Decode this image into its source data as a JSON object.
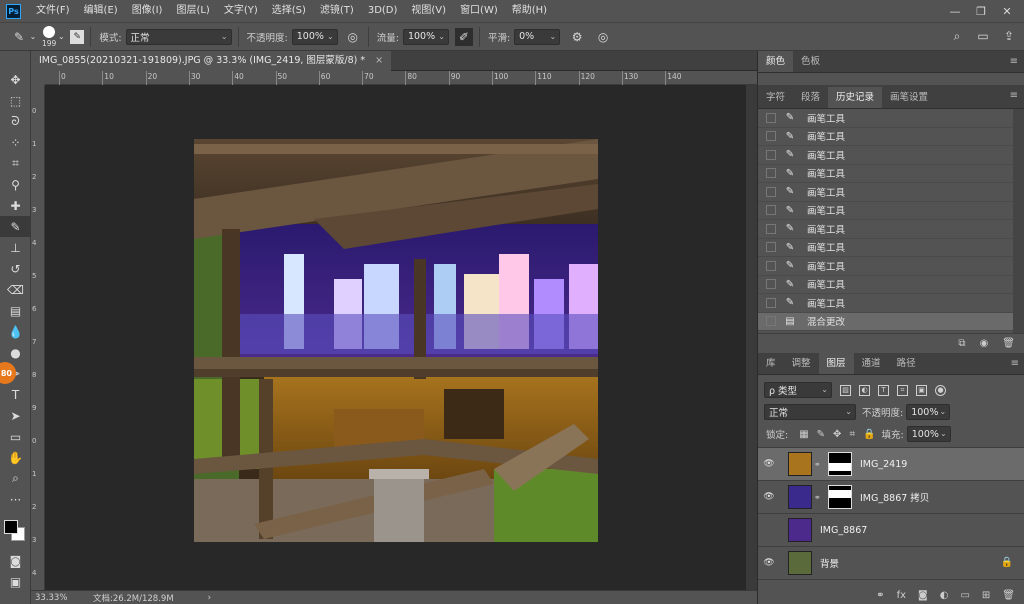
{
  "app": {
    "logo": "Ps",
    "menu": [
      "文件(F)",
      "编辑(E)",
      "图像(I)",
      "图层(L)",
      "文字(Y)",
      "选择(S)",
      "滤镜(T)",
      "3D(D)",
      "视图(V)",
      "窗口(W)",
      "帮助(H)"
    ],
    "window_controls": [
      "—",
      "❐",
      "✕"
    ]
  },
  "options": {
    "brush_size": "199",
    "mode_label": "模式:",
    "mode_value": "正常",
    "opacity_label": "不透明度:",
    "opacity_value": "100%",
    "flow_label": "流量:",
    "flow_value": "100%",
    "smooth_label": "平滑:",
    "smooth_value": "0%"
  },
  "document": {
    "tab_title": "IMG_0855(20210321-191809).JPG @ 33.3% (IMG_2419, 图层蒙版/8) *",
    "tab_close": "×",
    "ruler_h": [
      "0",
      "10",
      "20",
      "30",
      "40",
      "50",
      "60",
      "70",
      "80",
      "90",
      "100",
      "110",
      "120",
      "130",
      "140"
    ],
    "ruler_v": [
      "0",
      "1",
      "2",
      "3",
      "4",
      "5",
      "6",
      "7",
      "8",
      "9",
      "0",
      "1",
      "2",
      "3",
      "4"
    ],
    "status_zoom": "33.33%",
    "status_doc": "文档:26.2M/128.9M",
    "status_arrow": "›"
  },
  "panels": {
    "top_tabs": [
      "颜色",
      "色板"
    ],
    "mid_tabs": [
      "字符",
      "段落",
      "历史记录",
      "画笔设置"
    ],
    "history": [
      "画笔工具",
      "画笔工具",
      "画笔工具",
      "画笔工具",
      "画笔工具",
      "画笔工具",
      "画笔工具",
      "画笔工具",
      "画笔工具",
      "画笔工具",
      "画笔工具",
      "混合更改"
    ],
    "layer_tabs": [
      "库",
      "调整",
      "图层",
      "通道",
      "路径"
    ],
    "layer_filter": "ρ 类型",
    "blend_mode": "正常",
    "layer_opacity_label": "不透明度:",
    "layer_opacity": "100%",
    "lock_label": "锁定:",
    "fill_label": "填充:",
    "fill_value": "100%",
    "layers": [
      {
        "name": "IMG_2419",
        "visible": true,
        "has_mask": true,
        "selected": true
      },
      {
        "name": "IMG_8867 拷贝",
        "visible": true,
        "has_mask": true,
        "selected": false
      },
      {
        "name": "IMG_8867",
        "visible": false,
        "has_mask": false,
        "selected": false
      },
      {
        "name": "背景",
        "visible": true,
        "has_mask": false,
        "selected": false,
        "locked": true
      }
    ],
    "footer_icons": [
      "link-icon",
      "fx-icon",
      "mask-icon",
      "adjustment-icon",
      "folder-icon",
      "new-layer-icon",
      "trash-icon"
    ]
  },
  "tool_badge": "80",
  "colors": {
    "accent_orange": "#e8781c",
    "ps_blue": "#31a8ff"
  }
}
